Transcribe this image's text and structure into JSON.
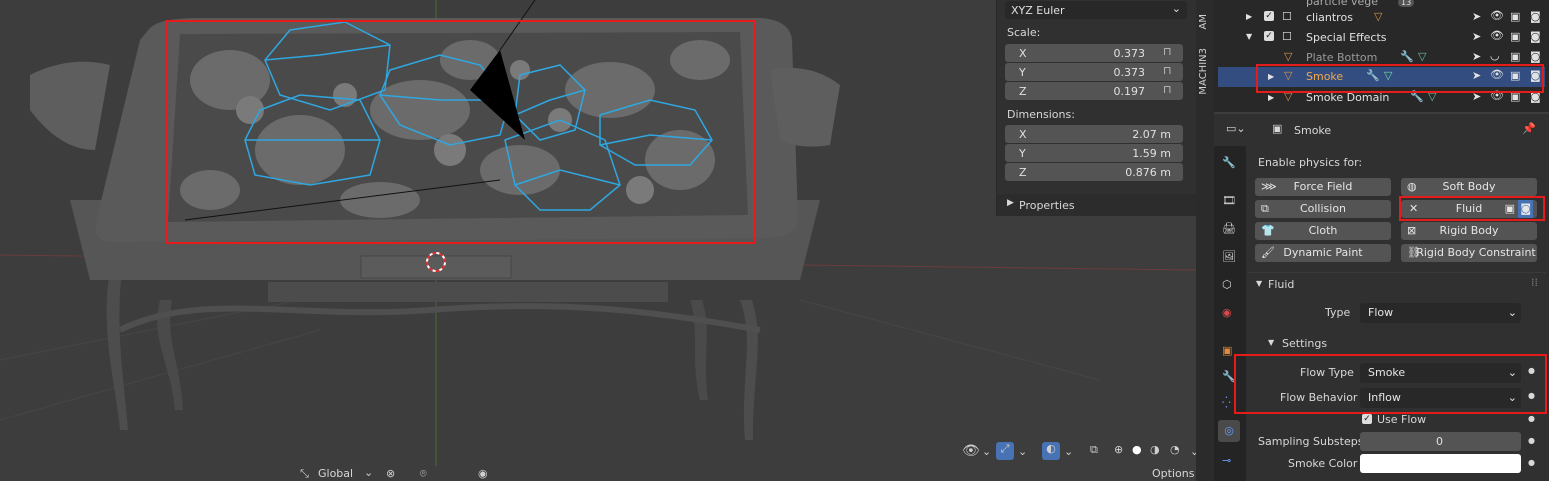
{
  "npanel": {
    "rotation_mode": "XYZ Euler",
    "scale_label": "Scale:",
    "scale": [
      {
        "axis": "X",
        "value": "0.373"
      },
      {
        "axis": "Y",
        "value": "0.373"
      },
      {
        "axis": "Z",
        "value": "0.197"
      }
    ],
    "dimensions_label": "Dimensions:",
    "dimensions": [
      {
        "axis": "X",
        "value": "2.07 m"
      },
      {
        "axis": "Y",
        "value": "1.59 m"
      },
      {
        "axis": "Z",
        "value": "0.876 m"
      }
    ],
    "properties_label": "Properties"
  },
  "vtabs": [
    "AM",
    "MACHIN3"
  ],
  "outliner": {
    "rows": [
      {
        "name": "particle vege"
      },
      {
        "name": "cliantros"
      },
      {
        "name": "Special Effects"
      },
      {
        "name": "Plate Bottom"
      },
      {
        "name": "Smoke"
      },
      {
        "name": "Smoke Domain"
      }
    ],
    "badge": "13"
  },
  "properties": {
    "object_name": "Smoke",
    "enable_physics_label": "Enable physics for:",
    "physics_buttons": [
      "Force Field",
      "Soft Body",
      "Collision",
      "Fluid",
      "Cloth",
      "Rigid Body",
      "Dynamic Paint",
      "Rigid Body Constraint"
    ],
    "fluid_panel": "Fluid",
    "type_label": "Type",
    "type_value": "Flow",
    "settings_label": "Settings",
    "flow_type_label": "Flow Type",
    "flow_type_value": "Smoke",
    "flow_behavior_label": "Flow Behavior",
    "flow_behavior_value": "Inflow",
    "use_flow_label": "Use Flow",
    "sampling_label": "Sampling Substeps",
    "sampling_value": "0",
    "smoke_color_label": "Smoke Color",
    "smoke_color": "#ffffff"
  },
  "bottom_bar": {
    "orientation": "Global",
    "options": "Options"
  },
  "colors": {
    "highlight": "#e51c1c",
    "selection": "#334d80",
    "wire": "#2fa7e0",
    "accent_orange": "#d9934a"
  }
}
